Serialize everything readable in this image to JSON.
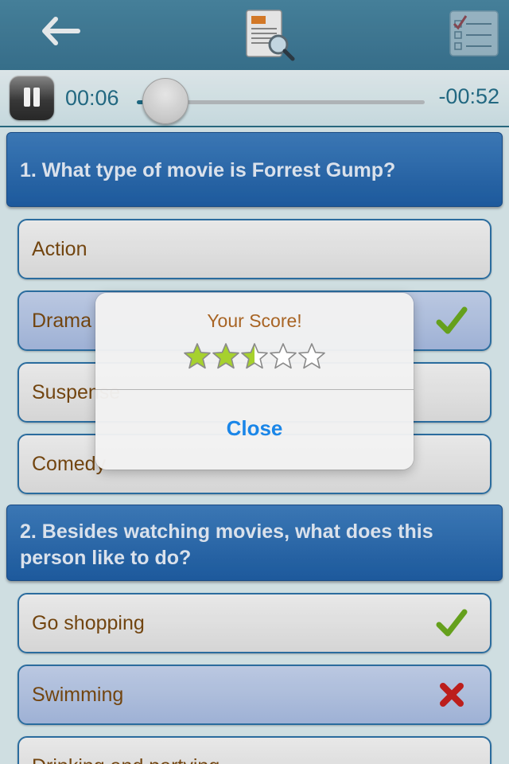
{
  "icons": {
    "back": "back-arrow-icon",
    "document": "document-search-icon",
    "quiz": "quiz-checklist-icon"
  },
  "player": {
    "elapsed": "00:06",
    "remaining": "-00:52",
    "progress": 0.1
  },
  "questions": [
    {
      "text": "1. What type of movie is Forrest Gump?",
      "answers": [
        {
          "label": "Action",
          "selected": false,
          "mark": ""
        },
        {
          "label": "Drama",
          "selected": true,
          "mark": "check"
        },
        {
          "label": "Suspense",
          "selected": false,
          "mark": ""
        },
        {
          "label": "Comedy",
          "selected": false,
          "mark": ""
        }
      ]
    },
    {
      "text": "2. Besides watching movies, what does this person like to do?",
      "answers": [
        {
          "label": "Go shopping",
          "selected": false,
          "mark": "check"
        },
        {
          "label": "Swimming",
          "selected": true,
          "mark": "cross"
        },
        {
          "label": "Drinking and partying",
          "selected": false,
          "mark": ""
        }
      ]
    }
  ],
  "dialog": {
    "title": "Your Score!",
    "rating": 2.5,
    "max_rating": 5,
    "close_label": "Close"
  },
  "colors": {
    "topbar": "#3f7b98",
    "question_bg": "#2a6ab1",
    "answer_text": "#7a4a12",
    "selected_bg": "#b8c9e9",
    "check": "#6cab1e",
    "cross": "#c8201e",
    "close": "#1a86e8",
    "dialog_title": "#a86424"
  }
}
